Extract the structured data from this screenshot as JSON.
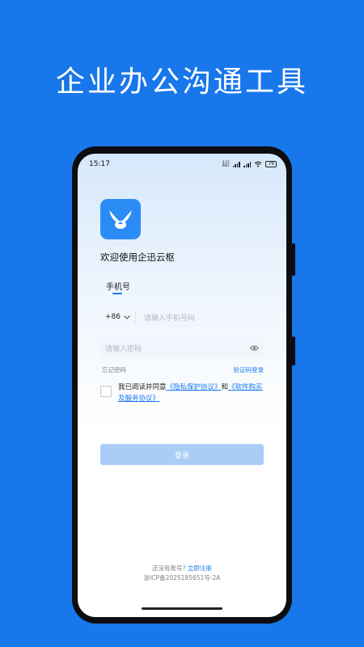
{
  "headline": "企业办公沟通工具",
  "status": {
    "time": "15:17",
    "speed_value": "3.15",
    "speed_unit": "KB/s",
    "battery": "79"
  },
  "app": {
    "welcome": "欢迎使用企迅云枢",
    "logo_icon": "app-logo-icon"
  },
  "login": {
    "tab_phone": "手机号",
    "country_code": "+86",
    "phone_placeholder": "请输入手机号码",
    "password_placeholder": "请输入密码",
    "forgot_password": "忘记密码",
    "sms_login": "验证码登录",
    "agreement_prefix": "我已阅读并同意",
    "privacy_link": "《隐私保护协议》",
    "agreement_and": "和",
    "service_link": "《软件购买及服务协议》",
    "login_button": "登录"
  },
  "footer": {
    "no_account": "还没有账号?",
    "register": "立即注册",
    "icp": "浙ICP备2025185651号-2A"
  },
  "colors": {
    "background": "#1877ea",
    "accent": "#1a7af0",
    "button_disabled": "#a9cdf7"
  }
}
